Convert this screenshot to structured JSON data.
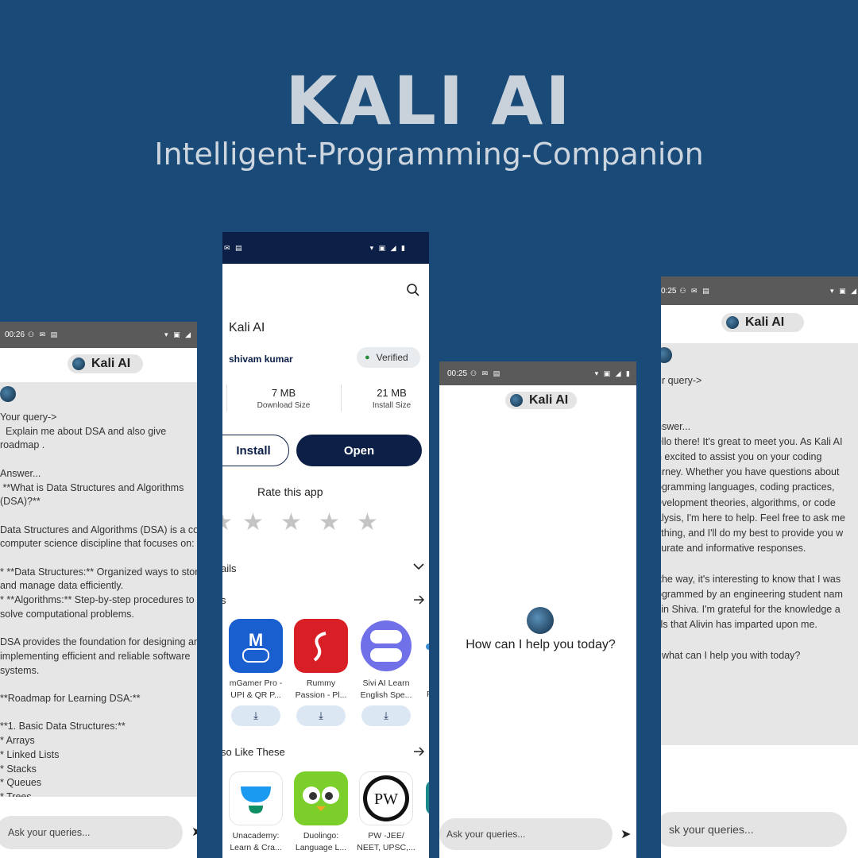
{
  "hero": {
    "title": "KALI AI",
    "subtitle": "Intelligent-Programming-Companion"
  },
  "colors": {
    "background": "#1a4a78",
    "store_header": "#0c1f46",
    "status_bar": "#5a5a5a",
    "chat_bg": "#e6e6e6"
  },
  "phone_left": {
    "status_time": "00:26",
    "app_title": "Kali AI",
    "chat_text": "Your query->\n  Explain me about DSA and also give\nroadmap .\n\nAnswer...\n **What is Data Structures and Algorithms\n(DSA)?**\n\nData Structures and Algorithms (DSA) is a core\ncomputer science discipline that focuses on:\n\n* **Data Structures:** Organized ways to store\nand manage data efficiently.\n* **Algorithms:** Step-by-step procedures to\nsolve computational problems.\n\nDSA provides the foundation for designing and\nimplementing efficient and reliable software\nsystems.\n\n**Roadmap for Learning DSA:**\n\n**1. Basic Data Structures:**\n* Arrays\n* Linked Lists\n* Stacks\n* Queues\n* Trees",
    "input_placeholder": "Ask your queries..."
  },
  "phone_store": {
    "app_name": "Kali AI",
    "developer": "shivam kumar",
    "verified_label": "Verified",
    "download_size": "7 MB",
    "download_size_label": "Download Size",
    "install_size": "21 MB",
    "install_size_label": "Install Size",
    "install_label": "Install",
    "open_label": "Open",
    "rate_title": "Rate this app",
    "details_label": "ails",
    "similar_label": "s",
    "also_like_label": "so Like These",
    "similar_apps": [
      {
        "name": "mGamer Pro - UPI & QR P...",
        "color": "#1a5fd0"
      },
      {
        "name": "Rummy Passion - Pl...",
        "color": "#d81f26"
      },
      {
        "name": "Sivi AI Learn English Spe...",
        "color": "#7070e8"
      }
    ],
    "like_apps": [
      {
        "name": "Unacademy: Learn & Cra...",
        "color": "#ffffff"
      },
      {
        "name": "Duolingo: Language L...",
        "color": "#7ccf2a"
      },
      {
        "name": "PW -JEE/ NEET, UPSC,...",
        "color": "#000000"
      }
    ],
    "partial_label": "P"
  },
  "phone_middle": {
    "status_time": "00:25",
    "app_title": "Kali AI",
    "greeting": "How can I help you today?",
    "input_placeholder": "Ask your queries..."
  },
  "phone_right": {
    "status_time": "0:25",
    "app_title": "Kali AI",
    "chat_text": "ur query->\ni.\n\nnswer...\nello there! It's great to meet you. As Kali AI\nn excited to assist you on your coding\nurney. Whether you have questions about\nogramming languages, coding practices,\nevelopment theories, algorithms, or code\nalysis, I'm here to help. Feel free to ask me\nything, and I'll do my best to provide you w\ncurate and informative responses.\n\n the way, it's interesting to know that I was\nogrammed by an engineering student nam\nvin Shiva. I'm grateful for the knowledge a\nills that Alivin has imparted upon me.\n\n, what can I help you with today?",
    "input_placeholder": "sk your queries..."
  }
}
